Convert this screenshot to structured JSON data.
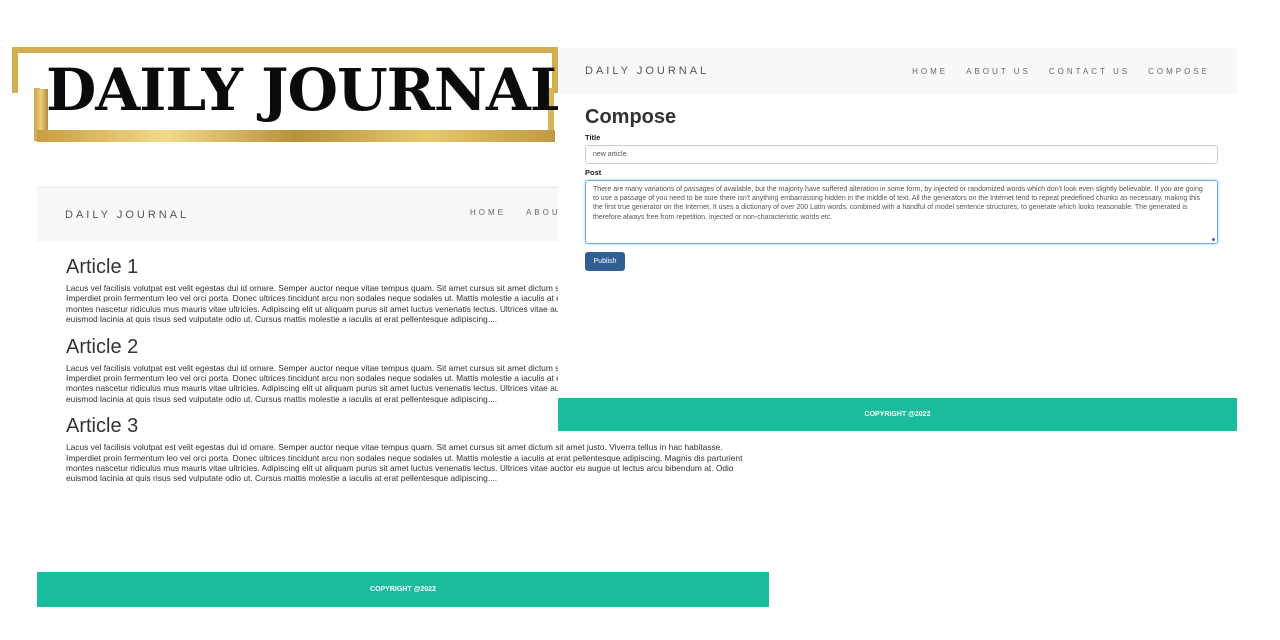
{
  "logo": {
    "text": "DAILY JOURNAL"
  },
  "home": {
    "brand": "DAILY JOURNAL",
    "nav": [
      "HOME",
      "ABOUT"
    ],
    "articles": [
      {
        "title": "Article 1",
        "body": "Lacus vel facilisis volutpat est velit egestas dui id ornare. Semper auctor neque vitae tempus quam. Sit amet cursus sit amet dictum sit amet justo. Viverra tellus in hac habitasse. Imperdiet proin fermentum leo vel orci porta. Donec ultrices tincidunt arcu non sodales neque sodales ut. Mattis molestie a iaculis at erat pellentesque adipiscing. Magnis dis parturient montes nascetur ridiculus mus mauris vitae ultricies. Adipiscing elit ut aliquam purus sit amet luctus venenatis lectus. Ultrices vitae auctor eu augue ut lectus arcu bibendum at. Odio euismod lacinia at quis risus sed vulputate odio ut. Cursus mattis molestie a iaculis at erat pellentesque adipiscing...."
      },
      {
        "title": "Article 2",
        "body": "Lacus vel facilisis volutpat est velit egestas dui id ornare. Semper auctor neque vitae tempus quam. Sit amet cursus sit amet dictum sit amet justo. Viverra tellus in hac habitasse. Imperdiet proin fermentum leo vel orci porta. Donec ultrices tincidunt arcu non sodales neque sodales ut. Mattis molestie a iaculis at erat pellentesque adipiscing. Magnis dis parturient montes nascetur ridiculus mus mauris vitae ultricies. Adipiscing elit ut aliquam purus sit amet luctus venenatis lectus. Ultrices vitae auctor eu augue ut lectus arcu bibendum at. Odio euismod lacinia at quis risus sed vulputate odio ut. Cursus mattis molestie a iaculis at erat pellentesque adipiscing...."
      },
      {
        "title": "Article 3",
        "body": "Lacus vel facilisis volutpat est velit egestas dui id ornare. Semper auctor neque vitae tempus quam. Sit amet cursus sit amet dictum sit amet justo. Viverra tellus in hac habitasse. Imperdiet proin fermentum leo vel orci porta. Donec ultrices tincidunt arcu non sodales neque sodales ut. Mattis molestie a iaculis at erat pellentesque adipiscing. Magnis dis parturient montes nascetur ridiculus mus mauris vitae ultricies. Adipiscing elit ut aliquam purus sit amet luctus venenatis lectus. Ultrices vitae auctor eu augue ut lectus arcu bibendum at. Odio euismod lacinia at quis risus sed vulputate odio ut. Cursus mattis molestie a iaculis at erat pellentesque adipiscing...."
      }
    ],
    "footer": "COPYRIGHT @2022"
  },
  "compose": {
    "brand": "DAILY JOURNAL",
    "nav": [
      "HOME",
      "ABOUT US",
      "CONTACT US",
      "COMPOSE"
    ],
    "heading": "Compose",
    "title_label": "Title",
    "title_value": "new article",
    "post_label": "Post",
    "post_value": "There are many variations of passages of available, but the majority have suffered alteration in some form, by injected or randomized words which don't look even slightly believable. If you are going to use a passage of you need to be sure there isn't anything embarrassing hidden in the middle of text. All the  generators on the Internet tend to repeat predefined chunks as necessary, making this the first true generator on the Internet. It uses a dictionary of over 200 Latin words, combined with a handful of model sentence structures, to generate which looks reasonable. The generated is therefore always free from repetition, injected  or non-characteristic words etc.",
    "publish_label": "Publish",
    "footer": "COPYRIGHT @2022"
  },
  "colors": {
    "accent": "#1abc9c",
    "button": "#2f5f93",
    "navbar": "#f8f8f8",
    "gold": "#d3ad4f"
  }
}
